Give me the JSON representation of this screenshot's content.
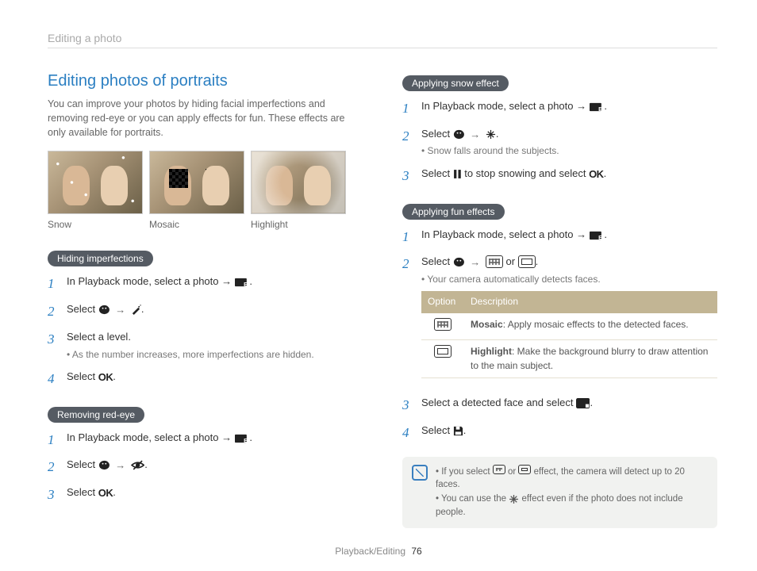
{
  "header": "Editing a photo",
  "left": {
    "title": "Editing photos of portraits",
    "intro": "You can improve your photos by hiding facial imperfections and removing red-eye or you can apply effects for fun. These effects are only available for portraits.",
    "thumb_labels": [
      "Snow",
      "Mosaic",
      "Highlight"
    ],
    "section1": {
      "heading": "Hiding imperfections",
      "step1": "In Playback mode, select a photo →",
      "step2a": "Select",
      "step2b": "→",
      "step2c": ".",
      "step3": "Select a level.",
      "step3_sub": "As the number increases, more imperfections are hidden.",
      "step4a": "Select",
      "step4b": ".",
      "ok": "OK"
    },
    "section2": {
      "heading": "Removing red-eye",
      "step1": "In Playback mode, select a photo →",
      "step2a": "Select",
      "step2b": "→",
      "step2c": ".",
      "step3a": "Select",
      "step3b": ".",
      "ok": "OK"
    }
  },
  "right": {
    "section1": {
      "heading": "Applying snow effect",
      "step1": "In Playback mode, select a photo →",
      "step2a": "Select",
      "step2b": "→",
      "step2c": ".",
      "step2_sub": "Snow falls around the subjects.",
      "step3a": "Select",
      "step3b": "to stop snowing and select",
      "step3c": ".",
      "ok": "OK"
    },
    "section2": {
      "heading": "Applying fun effects",
      "step1": "In Playback mode, select a photo →",
      "step2a": "Select",
      "step2b": "→",
      "step2c": "or",
      "step2d": ".",
      "step2_sub": "Your camera automatically detects faces.",
      "table": {
        "h1": "Option",
        "h2": "Description",
        "r1_name": "Mosaic",
        "r1_desc": ": Apply mosaic effects to the detected faces.",
        "r2_name": "Highlight",
        "r2_desc": ": Make the background blurry to draw attention to the main subject."
      },
      "step3a": "Select a detected face and select",
      "step3b": ".",
      "step4a": "Select",
      "step4b": "."
    },
    "note": {
      "l1a": "If you select",
      "l1b": "or",
      "l1c": "effect, the camera will detect up to 20 faces.",
      "l2a": "You can use the",
      "l2b": "effect even if the photo does not include people."
    }
  },
  "footer": {
    "section": "Playback/Editing",
    "page": "76"
  }
}
